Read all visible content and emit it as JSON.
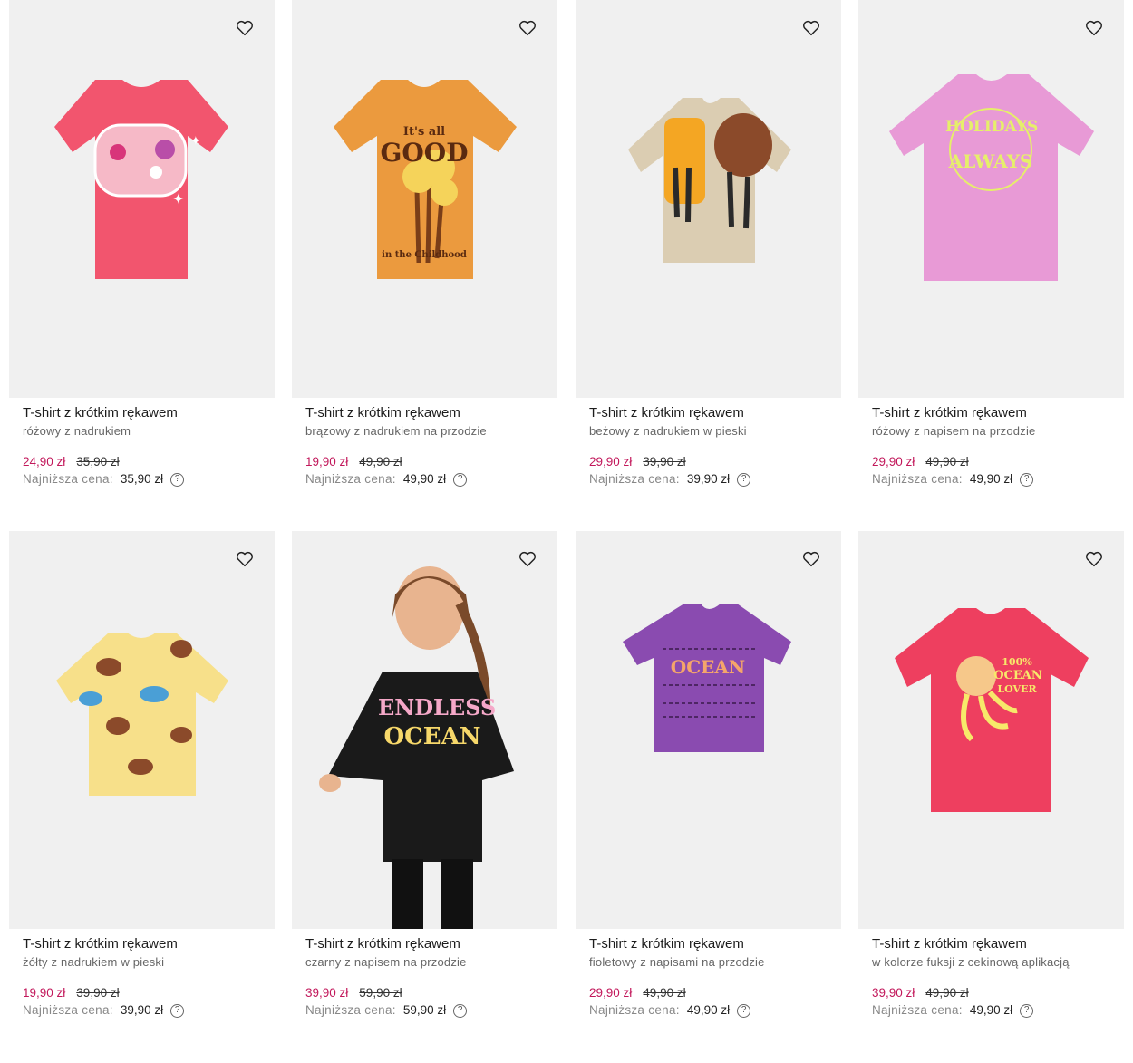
{
  "products": [
    {
      "title": "T-shirt z krótkim rękawem",
      "subtitle": "różowy z nadrukiem",
      "sale_price": "24,90 zł",
      "old_price": "35,90 zł",
      "lowest_label": "Najniższa cena:",
      "lowest_price": "35,90 zł",
      "color": "#f2556e"
    },
    {
      "title": "T-shirt z krótkim rękawem",
      "subtitle": "brązowy z nadrukiem na przodzie",
      "sale_price": "19,90 zł",
      "old_price": "49,90 zł",
      "lowest_label": "Najniższa cena:",
      "lowest_price": "49,90 zł",
      "color": "#eb9a3e",
      "print_top": "It's all",
      "print_main": "GOOD",
      "print_bottom": "in the Childhood"
    },
    {
      "title": "T-shirt z krótkim rękawem",
      "subtitle": "beżowy z nadrukiem w pieski",
      "sale_price": "29,90 zł",
      "old_price": "39,90 zł",
      "lowest_label": "Najniższa cena:",
      "lowest_price": "39,90 zł",
      "color": "#dbcdb2"
    },
    {
      "title": "T-shirt z krótkim rękawem",
      "subtitle": "różowy z napisem na przodzie",
      "sale_price": "29,90 zł",
      "old_price": "49,90 zł",
      "lowest_label": "Najniższa cena:",
      "lowest_price": "49,90 zł",
      "color": "#e89ad6",
      "print_top": "HOLIDAYS",
      "print_main": "ALWAYS"
    },
    {
      "title": "T-shirt z krótkim rękawem",
      "subtitle": "żółty z nadrukiem w pieski",
      "sale_price": "19,90 zł",
      "old_price": "39,90 zł",
      "lowest_label": "Najniższa cena:",
      "lowest_price": "39,90 zł",
      "color": "#f7e08a"
    },
    {
      "title": "T-shirt z krótkim rękawem",
      "subtitle": "czarny z napisem na przodzie",
      "sale_price": "39,90 zł",
      "old_price": "59,90 zł",
      "lowest_label": "Najniższa cena:",
      "lowest_price": "59,90 zł",
      "color": "#1a1a1a",
      "print_top": "ENDLESS",
      "print_main": "OCEAN"
    },
    {
      "title": "T-shirt z krótkim rękawem",
      "subtitle": "fioletowy z napisami na przodzie",
      "sale_price": "29,90 zł",
      "old_price": "49,90 zł",
      "lowest_label": "Najniższa cena:",
      "lowest_price": "49,90 zł",
      "color": "#8a4bb0",
      "print_main": "OCEAN"
    },
    {
      "title": "T-shirt z krótkim rękawem",
      "subtitle": "w kolorze fuksji z cekinową aplikacją",
      "sale_price": "39,90 zł",
      "old_price": "49,90 zł",
      "lowest_label": "Najniższa cena:",
      "lowest_price": "49,90 zł",
      "color": "#ee3f5f",
      "print_top": "100%",
      "print_main": "OCEAN",
      "print_bottom": "LOVER"
    }
  ],
  "icons": {
    "favorite": "heart-outline-icon",
    "help": "question-circle-icon"
  }
}
